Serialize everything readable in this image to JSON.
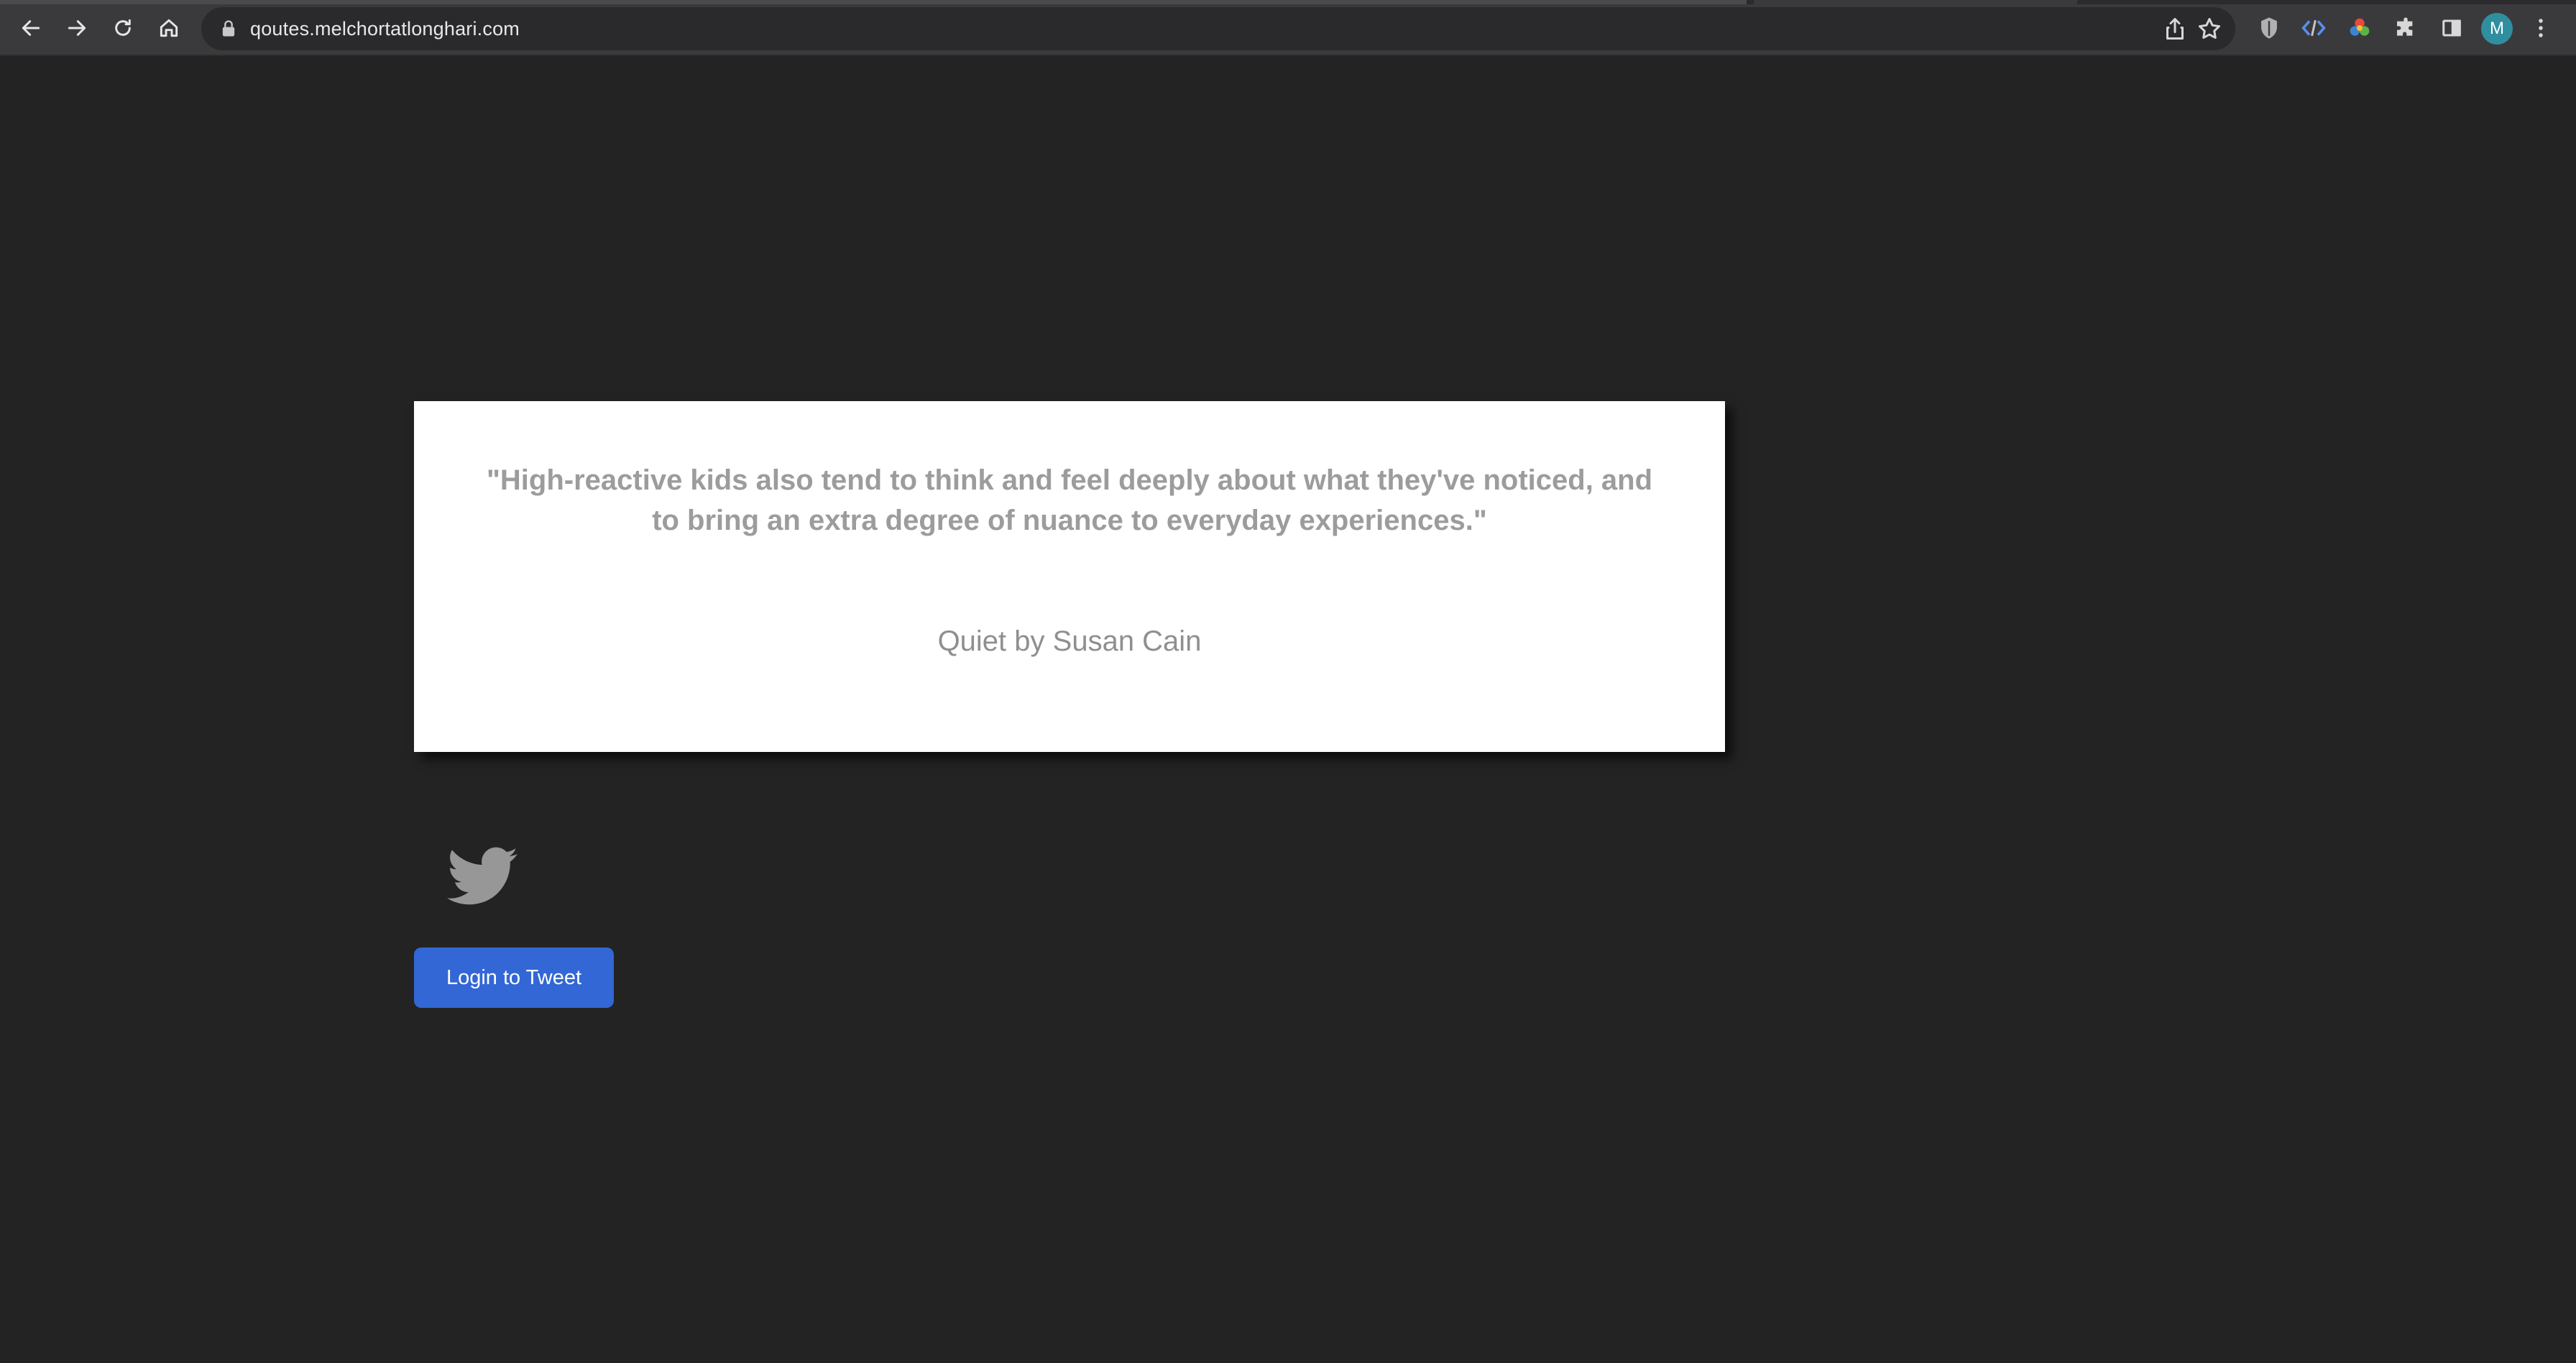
{
  "browser": {
    "url": "qoutes.melchortatlonghari.com",
    "profile_initial": "M",
    "icons": {
      "back": "arrow-left-icon",
      "forward": "arrow-right-icon",
      "reload": "reload-icon",
      "home": "home-icon",
      "lock": "lock-icon",
      "share": "share-icon",
      "bookmark": "star-icon",
      "extensions": "puzzle-icon",
      "sidepanel": "side-panel-icon",
      "menu": "kebab-menu-icon"
    }
  },
  "quote": {
    "text": "\"High-reactive kids also tend to think and feel deeply about what they've noticed, and to bring an extra degree of nuance to everyday experiences.\"",
    "source": "Quiet by Susan Cain"
  },
  "actions": {
    "login_label": "Login to Tweet"
  },
  "colors": {
    "page_background": "#232323",
    "card_background": "#ffffff",
    "button_background": "#3367d6",
    "text_gray": "#9c9c9c"
  }
}
